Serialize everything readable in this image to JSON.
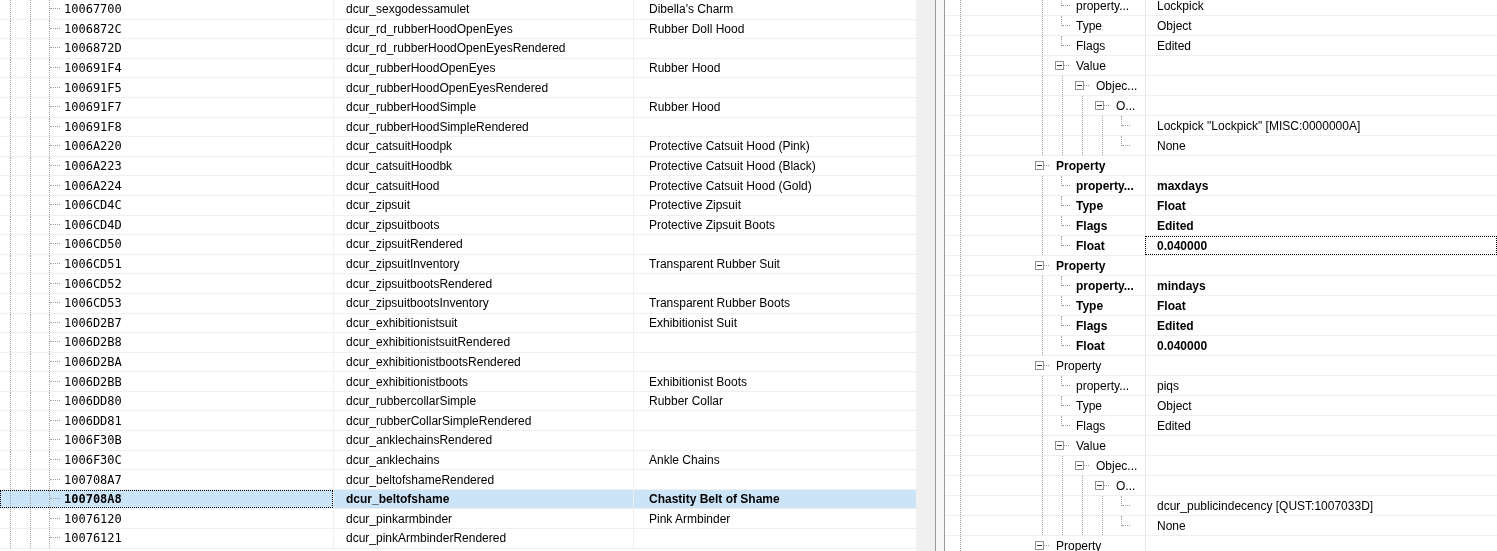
{
  "records": [
    {
      "form_id": "10067700",
      "editor_id": "dcur_sexgodessamulet",
      "name": "Dibella's Charm",
      "selected": false
    },
    {
      "form_id": "1006872C",
      "editor_id": "dcur_rd_rubberHoodOpenEyes",
      "name": "Rubber Doll Hood",
      "selected": false
    },
    {
      "form_id": "1006872D",
      "editor_id": "dcur_rd_rubberHoodOpenEyesRendered",
      "selected": false
    },
    {
      "form_id": "100691F4",
      "editor_id": "dcur_rubberHoodOpenEyes",
      "name": "Rubber Hood",
      "selected": false
    },
    {
      "form_id": "100691F5",
      "editor_id": "dcur_rubberHoodOpenEyesRendered",
      "selected": false
    },
    {
      "form_id": "100691F7",
      "editor_id": "dcur_rubberHoodSimple",
      "name": "Rubber Hood",
      "selected": false
    },
    {
      "form_id": "100691F8",
      "editor_id": "dcur_rubberHoodSimpleRendered",
      "selected": false
    },
    {
      "form_id": "1006A220",
      "editor_id": "dcur_catsuitHoodpk",
      "name": "Protective Catsuit Hood (Pink)",
      "selected": false
    },
    {
      "form_id": "1006A223",
      "editor_id": "dcur_catsuitHoodbk",
      "name": "Protective Catsuit Hood (Black)",
      "selected": false
    },
    {
      "form_id": "1006A224",
      "editor_id": "dcur_catsuitHood",
      "name": "Protective Catsuit Hood (Gold)",
      "selected": false
    },
    {
      "form_id": "1006CD4C",
      "editor_id": "dcur_zipsuit",
      "name": "Protective Zipsuit",
      "selected": false
    },
    {
      "form_id": "1006CD4D",
      "editor_id": "dcur_zipsuitboots",
      "name": "Protective Zipsuit Boots",
      "selected": false
    },
    {
      "form_id": "1006CD50",
      "editor_id": "dcur_zipsuitRendered",
      "selected": false
    },
    {
      "form_id": "1006CD51",
      "editor_id": "dcur_zipsuitInventory",
      "name": "Transparent Rubber Suit",
      "selected": false
    },
    {
      "form_id": "1006CD52",
      "editor_id": "dcur_zipsuitbootsRendered",
      "selected": false
    },
    {
      "form_id": "1006CD53",
      "editor_id": "dcur_zipsuitbootsInventory",
      "name": "Transparent Rubber Boots",
      "selected": false
    },
    {
      "form_id": "1006D2B7",
      "editor_id": "dcur_exhibitionistsuit",
      "name": "Exhibitionist Suit",
      "selected": false
    },
    {
      "form_id": "1006D2B8",
      "editor_id": "dcur_exhibitionistsuitRendered",
      "selected": false
    },
    {
      "form_id": "1006D2BA",
      "editor_id": "dcur_exhibitionistbootsRendered",
      "selected": false
    },
    {
      "form_id": "1006D2BB",
      "editor_id": "dcur_exhibitionistboots",
      "name": "Exhibitionist Boots",
      "selected": false
    },
    {
      "form_id": "1006DD80",
      "editor_id": "dcur_rubbercollarSimple",
      "name": "Rubber Collar",
      "selected": false
    },
    {
      "form_id": "1006DD81",
      "editor_id": "dcur_rubberCollarSimpleRendered",
      "selected": false
    },
    {
      "form_id": "1006F30B",
      "editor_id": "dcur_anklechainsRendered",
      "selected": false
    },
    {
      "form_id": "1006F30C",
      "editor_id": "dcur_anklechains",
      "name": "Ankle Chains",
      "selected": false
    },
    {
      "form_id": "100708A7",
      "editor_id": "dcur_beltofshameRendered",
      "selected": false
    },
    {
      "form_id": "100708A8",
      "editor_id": "dcur_beltofshame",
      "name": "Chastity Belt of Shame",
      "selected": true
    },
    {
      "form_id": "10076120",
      "editor_id": "dcur_pinkarmbinder",
      "name": "Pink Armbinder",
      "selected": false
    },
    {
      "form_id": "10076121",
      "editor_id": "dcur_pinkArmbinderRendered",
      "selected": false
    }
  ],
  "property_tree": [
    {
      "children": [
        {
          "label": "property...",
          "value": "Lockpick",
          "bold": false
        },
        {
          "label": "Type",
          "value": "Object",
          "bold": false
        },
        {
          "label": "Flags",
          "value": "Edited",
          "bold": false
        },
        {
          "label": "Value",
          "bold": false,
          "expanded": true,
          "children": [
            {
              "label": "Objec...",
              "bold": false,
              "expanded": true,
              "children": [
                {
                  "label": "O...",
                  "bold": false,
                  "expanded": true,
                  "children": [
                    {
                      "value": "Lockpick \"Lockpick\" [MISC:0000000A]",
                      "bold": false
                    },
                    {
                      "value": "None",
                      "bold": false
                    }
                  ]
                }
              ]
            }
          ]
        }
      ]
    },
    {
      "label": "Property",
      "bold": true,
      "expanded": true,
      "children": [
        {
          "label": "property...",
          "value": "maxdays",
          "bold": true
        },
        {
          "label": "Type",
          "value": "Float",
          "bold": true
        },
        {
          "label": "Flags",
          "value": "Edited",
          "bold": true
        },
        {
          "label": "Float",
          "value": "0.040000",
          "bold": true,
          "focused": true
        }
      ]
    },
    {
      "label": "Property",
      "bold": true,
      "expanded": true,
      "children": [
        {
          "label": "property...",
          "value": "mindays",
          "bold": true
        },
        {
          "label": "Type",
          "value": "Float",
          "bold": true
        },
        {
          "label": "Flags",
          "value": "Edited",
          "bold": true
        },
        {
          "label": "Float",
          "value": "0.040000",
          "bold": true
        }
      ]
    },
    {
      "label": "Property",
      "bold": false,
      "expanded": true,
      "children": [
        {
          "label": "property...",
          "value": "piqs",
          "bold": false
        },
        {
          "label": "Type",
          "value": "Object",
          "bold": false
        },
        {
          "label": "Flags",
          "value": "Edited",
          "bold": false
        },
        {
          "label": "Value",
          "bold": false,
          "expanded": true,
          "children": [
            {
              "label": "Objec...",
              "bold": false,
              "expanded": true,
              "children": [
                {
                  "label": "O...",
                  "bold": false,
                  "expanded": true,
                  "children": [
                    {
                      "value": "dcur_publicindecency [QUST:1007033D]",
                      "bold": false
                    },
                    {
                      "value": "None",
                      "bold": false
                    }
                  ]
                }
              ]
            }
          ]
        }
      ]
    },
    {
      "label": "Property",
      "bold": false,
      "expanded": true
    }
  ]
}
